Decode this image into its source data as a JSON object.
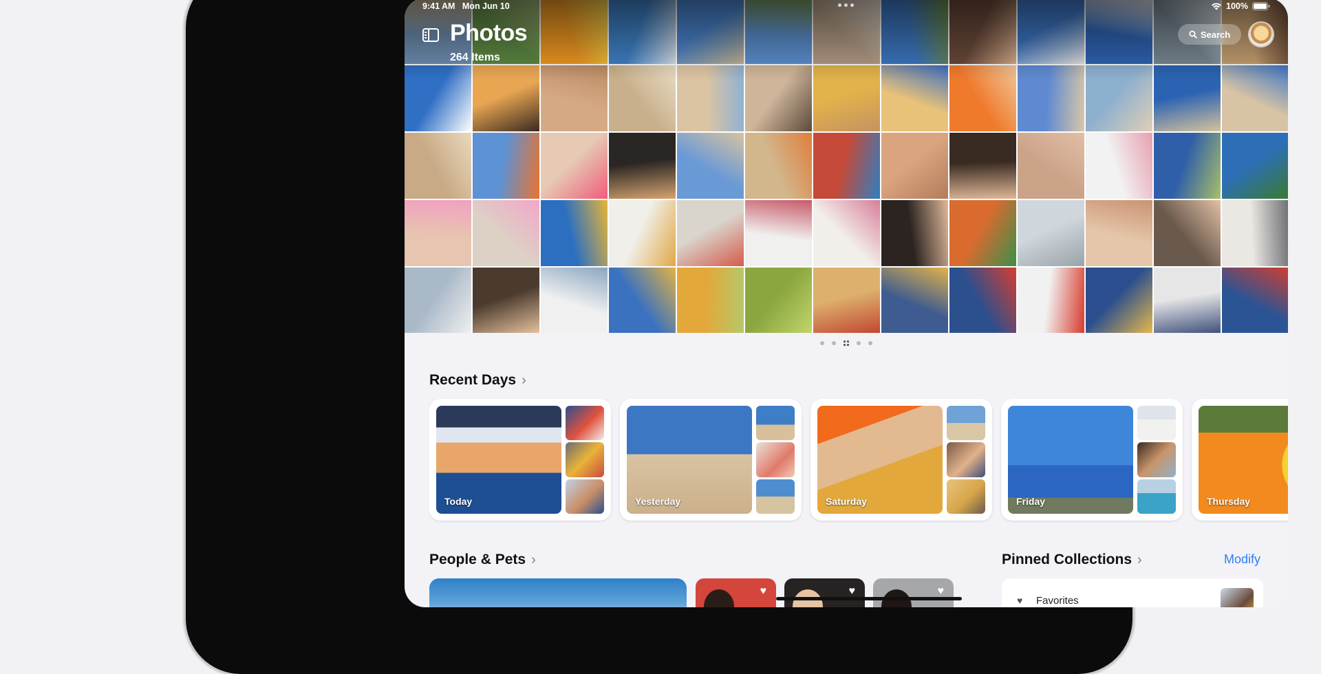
{
  "status_bar": {
    "time": "9:41 AM",
    "date": "Mon Jun 10",
    "battery": "100%"
  },
  "header": {
    "title": "Photos",
    "item_count": "264 Items",
    "search_label": "Search"
  },
  "icons": {
    "sidebar_toggle": "sidebar-icon",
    "search": "search-icon",
    "profile": "avatar-icon",
    "wifi": "wifi-icon",
    "battery": "battery-icon",
    "heart": "heart-icon",
    "chevron": "chevron-right-icon"
  },
  "sections": {
    "recent_days": "Recent Days",
    "people_pets": "People & Pets",
    "pinned_collections": "Pinned Collections",
    "modify": "Modify"
  },
  "recent_days": [
    {
      "label": "Today"
    },
    {
      "label": "Yesterday"
    },
    {
      "label": "Saturday"
    },
    {
      "label": "Friday"
    },
    {
      "label": "Thursday"
    }
  ],
  "pinned": {
    "first_item": "Favorites"
  },
  "colors": {
    "accent": "#2f7cf6",
    "background": "#f2f2f7"
  }
}
